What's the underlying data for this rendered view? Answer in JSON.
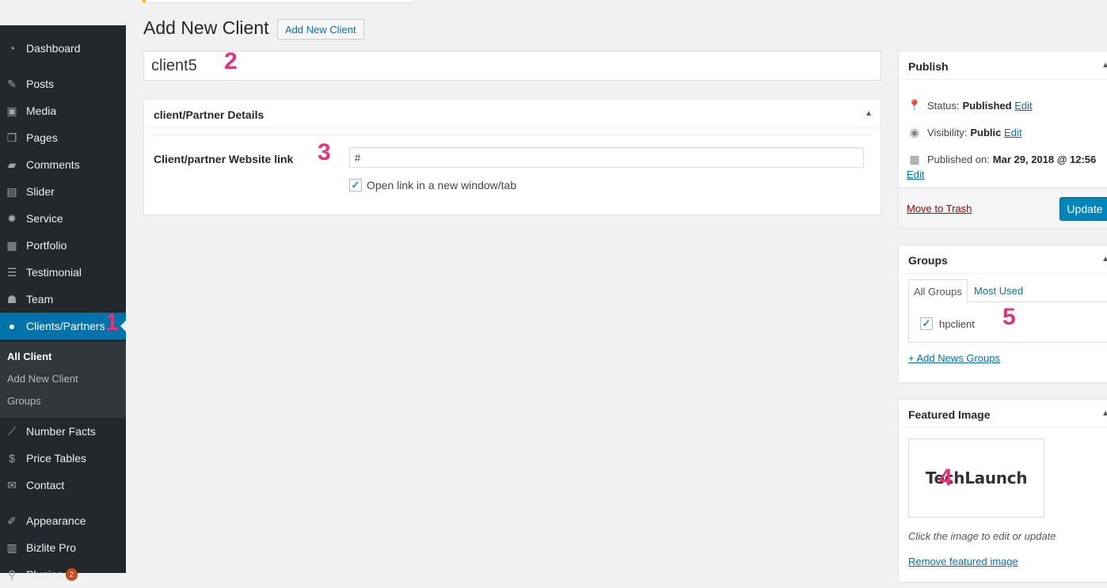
{
  "header": {
    "title": "Add New Client",
    "add_new_label": "Add New Client"
  },
  "post_title": "client5",
  "markers": [
    "1",
    "2",
    "3",
    "4",
    "5"
  ],
  "sidebar": {
    "items": [
      {
        "label": "Dashboard",
        "icon": "dashboard-icon"
      },
      {
        "label": "Posts",
        "icon": "pin-icon"
      },
      {
        "label": "Media",
        "icon": "media-icon"
      },
      {
        "label": "Pages",
        "icon": "pages-icon"
      },
      {
        "label": "Comments",
        "icon": "comment-icon"
      },
      {
        "label": "Slider",
        "icon": "slider-icon"
      },
      {
        "label": "Service",
        "icon": "gear-icon"
      },
      {
        "label": "Portfolio",
        "icon": "portfolio-icon"
      },
      {
        "label": "Testimonial",
        "icon": "list-icon"
      },
      {
        "label": "Team",
        "icon": "team-icon"
      },
      {
        "label": "Clients/Partners",
        "icon": "user-icon",
        "active": true
      },
      {
        "label": "Number Facts",
        "icon": "chart-line-icon"
      },
      {
        "label": "Price Tables",
        "icon": "dollar-icon"
      },
      {
        "label": "Contact",
        "icon": "envelope-icon"
      },
      {
        "label": "Appearance",
        "icon": "paintbrush-icon"
      },
      {
        "label": "Bizlite Pro",
        "icon": "layout-icon"
      },
      {
        "label": "Plugins",
        "icon": "plugin-icon",
        "badge": "2"
      }
    ],
    "submenu": [
      "All Client",
      "Add New Client",
      "Groups"
    ]
  },
  "details": {
    "title": "client/Partner Details",
    "field_label": "Client/partner Website link",
    "link_value": "#",
    "newtab_label": "Open link in a new window/tab"
  },
  "publish": {
    "title": "Publish",
    "status_label": "Status:",
    "status_value": "Published",
    "visibility_label": "Visibility:",
    "visibility_value": "Public",
    "published_label": "Published on:",
    "published_value": "Mar 29, 2018 @ 12:56",
    "edit": "Edit",
    "trash": "Move to Trash",
    "update": "Update"
  },
  "groups": {
    "title": "Groups",
    "tab_all": "All Groups",
    "tab_most": "Most Used",
    "item": "hpclient",
    "add_link": "+ Add News Groups"
  },
  "featured": {
    "title": "Featured Image",
    "logo_text": "TechLaunch",
    "hint": "Click the image to edit or update",
    "remove": "Remove featured image"
  },
  "colors": {
    "admin_bar": "#23282d",
    "accent": "#0073aa",
    "marker": "#e5317a",
    "update_button": "#0085ba"
  }
}
